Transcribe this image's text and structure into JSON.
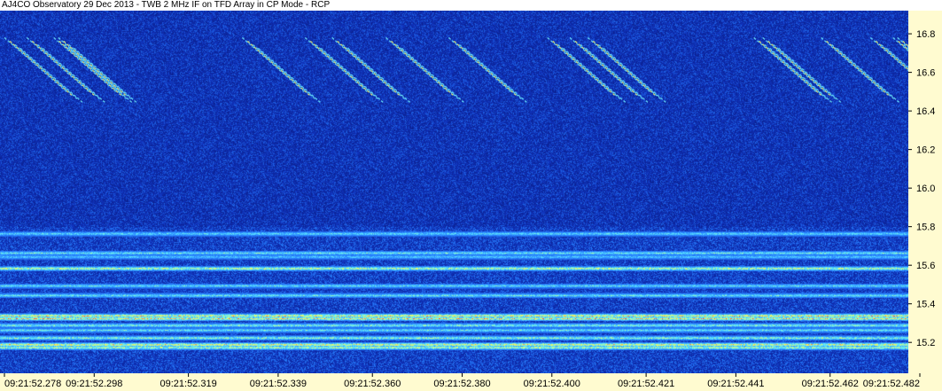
{
  "window": {
    "title": "AJ4CO Observatory 29 Dec 2013 - TWB 2 MHz IF on TFD Array in CP Mode - RCP"
  },
  "chart_data": {
    "type": "heatmap",
    "title": "AJ4CO Observatory 29 Dec 2013 - TWB 2 MHz IF on TFD Array in CP Mode - RCP",
    "xlabel": "",
    "ylabel": "",
    "x_ticks": [
      "09:21:52.278",
      "09:21:52.298",
      "09:21:52.319",
      "09:21:52.339",
      "09:21:52.360",
      "09:21:52.380",
      "09:21:52.400",
      "09:21:52.421",
      "09:21:52.441",
      "09:21:52.462",
      "09:21:52.482"
    ],
    "y_ticks": [
      15.2,
      15.4,
      15.6,
      15.8,
      16.0,
      16.2,
      16.4,
      16.6,
      16.8
    ],
    "ylim": [
      15.04,
      16.92
    ],
    "xlim": [
      "09:21:52.278",
      "09:21:52.482"
    ],
    "grid": false,
    "colors": {
      "background": "#0a2aa8",
      "low": "#0a1e8c",
      "mid": "#2b8cff",
      "high_cyan": "#5cf0ff",
      "high_yellow": "#ffff60",
      "high_red": "#ff4040",
      "axis_panel": "#fffbd0"
    },
    "interference_bands_mhz": [
      {
        "freq": 15.765,
        "intensity": 0.55
      },
      {
        "freq": 15.665,
        "intensity": 0.6
      },
      {
        "freq": 15.645,
        "intensity": 0.5
      },
      {
        "freq": 15.585,
        "intensity": 0.9
      },
      {
        "freq": 15.495,
        "intensity": 0.55
      },
      {
        "freq": 15.445,
        "intensity": 0.6
      },
      {
        "freq": 15.34,
        "intensity": 1.0
      },
      {
        "freq": 15.325,
        "intensity": 0.95
      },
      {
        "freq": 15.29,
        "intensity": 0.7
      },
      {
        "freq": 15.265,
        "intensity": 0.6
      },
      {
        "freq": 15.225,
        "intensity": 0.75
      },
      {
        "freq": 15.19,
        "intensity": 1.0
      },
      {
        "freq": 15.175,
        "intensity": 0.85
      }
    ],
    "burst_start_times": [
      "09:21:52.278",
      "09:21:52.283",
      "09:21:52.289",
      "09:21:52.290",
      "09:21:52.331",
      "09:21:52.345",
      "09:21:52.351",
      "09:21:52.363",
      "09:21:52.377",
      "09:21:52.399",
      "09:21:52.404",
      "09:21:52.408",
      "09:21:52.445",
      "09:21:52.447",
      "09:21:52.460",
      "09:21:52.471",
      "09:21:52.476",
      "09:21:52.477"
    ]
  }
}
